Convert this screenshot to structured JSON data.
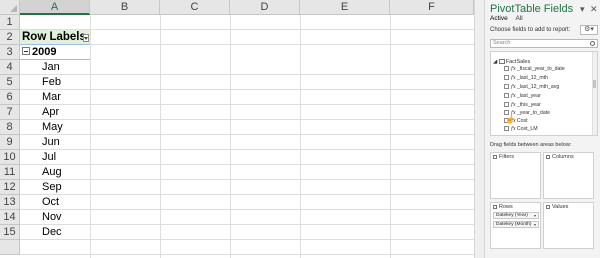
{
  "spreadsheet": {
    "columns": [
      "A",
      "B",
      "C",
      "D",
      "E",
      "F"
    ],
    "rows": [
      "1",
      "2",
      "3",
      "4",
      "5",
      "6",
      "7",
      "8",
      "9",
      "10",
      "11",
      "12",
      "13",
      "14",
      "15"
    ],
    "pivot": {
      "header_label": "Row Labels",
      "year": "2009",
      "months": [
        "Jan",
        "Feb",
        "Mar",
        "Apr",
        "May",
        "Jun",
        "Jul",
        "Aug",
        "Sep",
        "Oct",
        "Nov",
        "Dec"
      ]
    }
  },
  "pane": {
    "title": "PivotTable Fields",
    "tabs": [
      "Active",
      "All"
    ],
    "choose_label": "Choose fields to add to report:",
    "search_placeholder": "Search",
    "table_name": "FactSales",
    "fields": [
      "_fiscal_year_to_date",
      "_last_12_mth",
      "_last_12_mth_avg",
      "_last_year",
      "_this_year",
      "_year_to_date",
      "Cost",
      "Cost_LM"
    ],
    "drag_label": "Drag fields between areas below:",
    "areas": {
      "filters": "Filters",
      "columns": "Columns",
      "rows": "Rows",
      "values": "Values"
    },
    "row_fields": [
      "Datekey (Year)",
      "Datekey (Month)"
    ]
  }
}
